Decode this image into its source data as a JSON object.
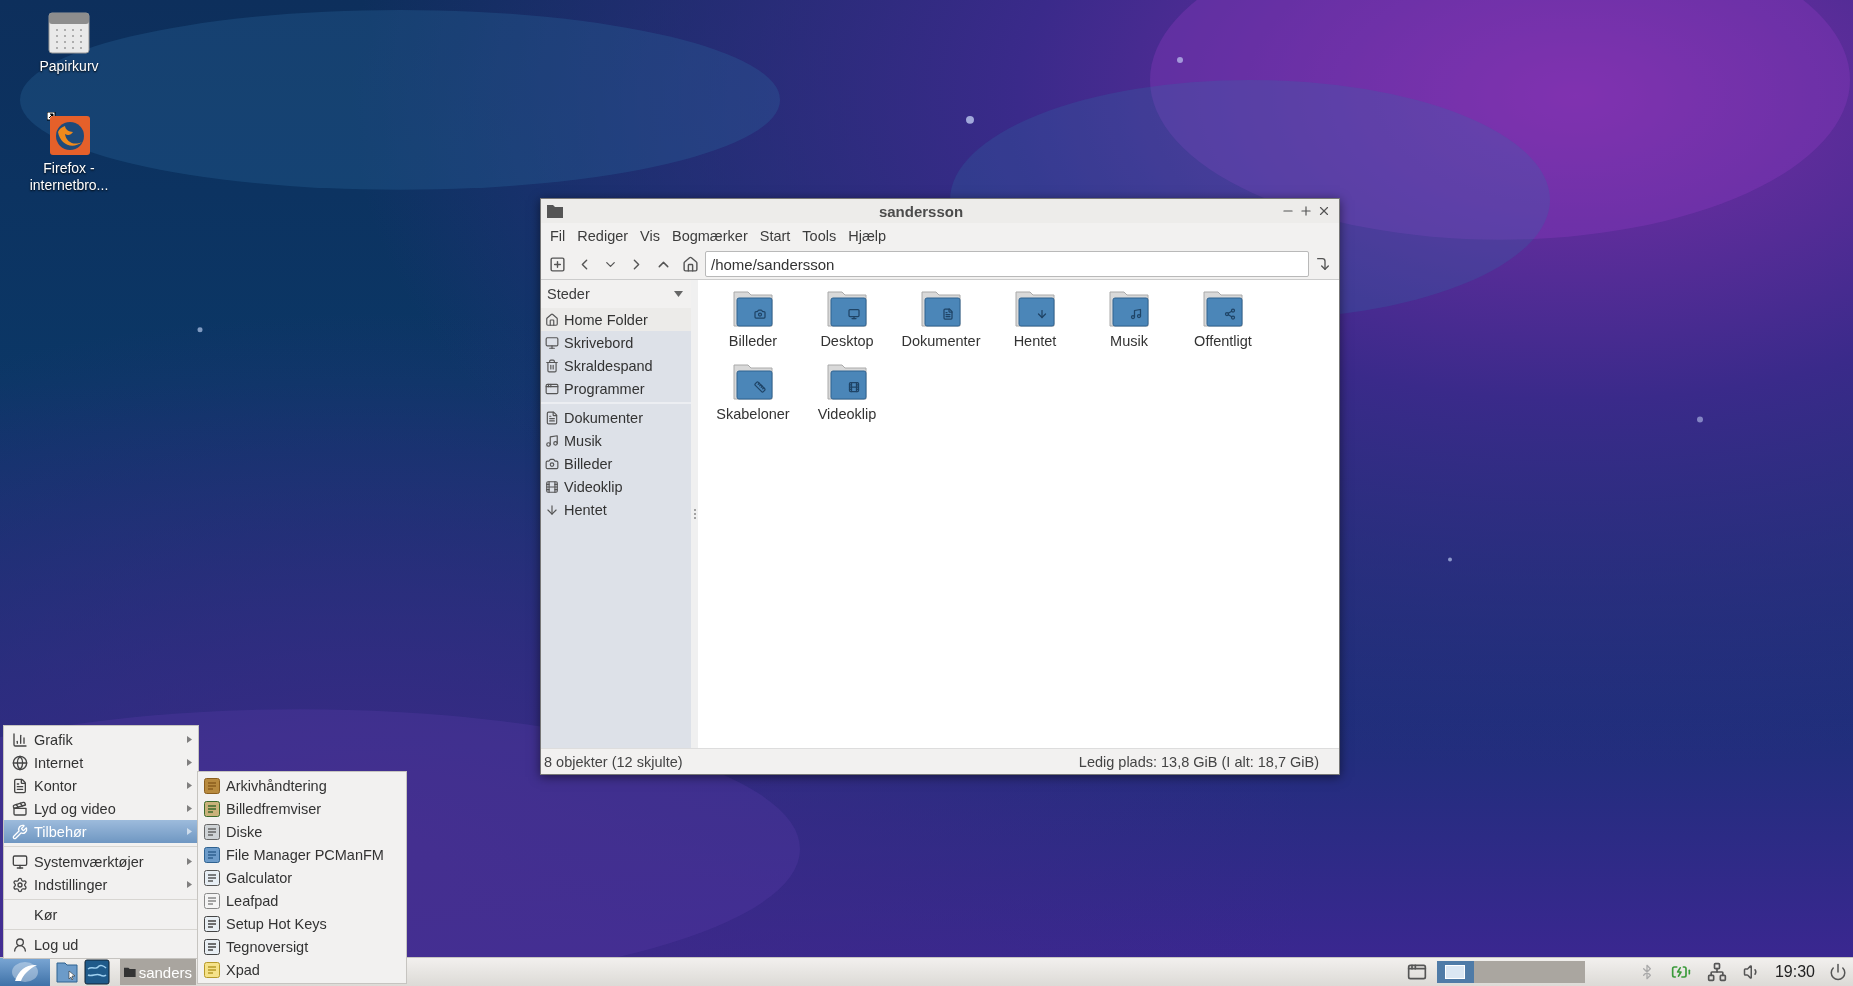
{
  "desktop_icons": [
    {
      "kind": "trash",
      "lines": [
        "Papirkurv"
      ]
    },
    {
      "kind": "browser",
      "lines": [
        "Firefox -",
        "internetbro..."
      ]
    }
  ],
  "window": {
    "title": "sandersson",
    "menu": [
      "Fil",
      "Rediger",
      "Vis",
      "Bogmærker",
      "Start",
      "Tools",
      "Hjælp"
    ],
    "path": "/home/sandersson",
    "sidebar": {
      "header": "Steder",
      "groups": [
        [
          {
            "label": "Home Folder",
            "selected": true
          },
          {
            "label": "Skrivebord",
            "selected": false
          },
          {
            "label": "Skraldespand",
            "selected": false
          },
          {
            "label": "Programmer",
            "selected": false
          }
        ],
        [
          {
            "label": "Dokumenter",
            "selected": false
          },
          {
            "label": "Musik",
            "selected": false
          },
          {
            "label": "Billeder",
            "selected": false
          },
          {
            "label": "Videoklip",
            "selected": false
          },
          {
            "label": "Hentet",
            "selected": false
          }
        ]
      ]
    },
    "files": [
      "Billeder",
      "Desktop",
      "Dokumenter",
      "Hentet",
      "Musik",
      "Offentligt",
      "Skabeloner",
      "Videoklip"
    ],
    "status_left": "8 objekter (12 skjulte)",
    "status_right": "Ledig plads: 13,8 GiB (I alt: 18,7 GiB)"
  },
  "app_menu": {
    "groups": [
      [
        {
          "label": "Grafik",
          "kind": "submenu",
          "selected": false
        },
        {
          "label": "Internet",
          "kind": "submenu",
          "selected": false
        },
        {
          "label": "Kontor",
          "kind": "submenu",
          "selected": false
        },
        {
          "label": "Lyd og video",
          "kind": "submenu",
          "selected": false
        },
        {
          "label": "Tilbehør",
          "kind": "submenu",
          "selected": true
        }
      ],
      [
        {
          "label": "Systemværktøjer",
          "kind": "submenu",
          "selected": false
        },
        {
          "label": "Indstillinger",
          "kind": "submenu",
          "selected": false
        }
      ],
      [
        {
          "label": "Kør",
          "kind": "action",
          "selected": false
        }
      ],
      [
        {
          "label": "Log ud",
          "kind": "action",
          "selected": false
        }
      ]
    ]
  },
  "submenu": [
    "Arkivhåndtering",
    "Billedfremviser",
    "Diske",
    "File Manager PCManFM",
    "Galculator",
    "Leafpad",
    "Setup Hot Keys",
    "Tegnoversigt",
    "Xpad"
  ],
  "taskbar": {
    "tasks": [
      "sanders"
    ],
    "pager": [
      {
        "selected": true
      },
      {
        "selected": false
      },
      {
        "selected": false
      },
      {
        "selected": false
      }
    ],
    "clock": "19:30"
  }
}
